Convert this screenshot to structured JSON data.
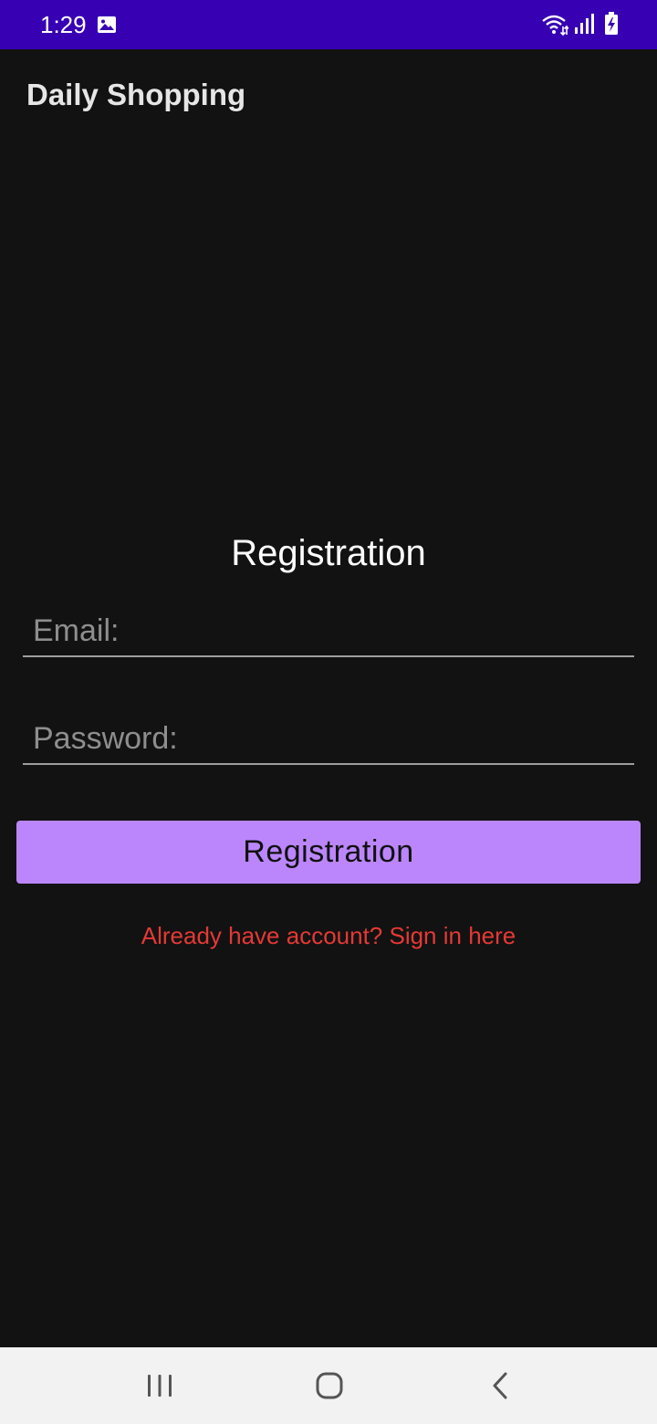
{
  "status_bar": {
    "time": "1:29",
    "icons": [
      "gallery-icon",
      "wifi-icon",
      "signal-icon",
      "battery-charging-icon"
    ],
    "background_color": "#3700B3"
  },
  "app_bar": {
    "title": "Daily Shopping"
  },
  "form": {
    "heading": "Registration",
    "email_placeholder": "Email:",
    "email_value": "",
    "password_placeholder": "Password:",
    "password_value": "",
    "submit_label": "Registration",
    "signin_link": "Already have account? Sign in here"
  },
  "colors": {
    "background": "#121212",
    "button": "#BB86FC",
    "link": "#E53935"
  },
  "nav_bar": {
    "icons": [
      "recents-icon",
      "home-icon",
      "back-icon"
    ]
  }
}
